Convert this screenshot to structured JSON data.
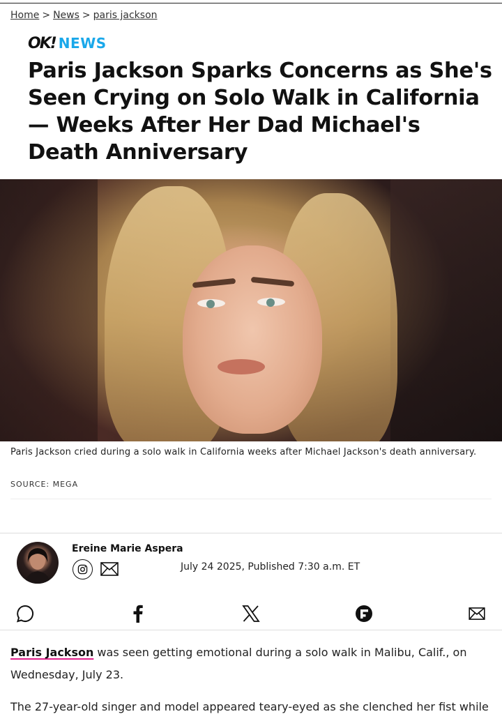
{
  "breadcrumb": {
    "home": "Home",
    "news": "News",
    "current": "paris jackson",
    "separator": ">"
  },
  "brand": {
    "logo": "OK!",
    "section": "NEWS",
    "section_color": "#1aa8ea"
  },
  "headline": "Paris Jackson Sparks Concerns as She's Seen Crying on Solo Walk in California — Weeks After Her Dad Michael's Death Anniversary",
  "hero": {
    "caption": "Paris Jackson cried during a solo walk in California weeks after Michael Jackson's death anniversary.",
    "source": "SOURCE: MEGA"
  },
  "author": {
    "name": "Ereine Marie Aspera",
    "social_icons": [
      "instagram-icon",
      "mail-icon"
    ],
    "date": "July 24 2025, Published 7:30 a.m. ET"
  },
  "share": {
    "icons": [
      "comment-icon",
      "facebook-icon",
      "x-icon",
      "flipboard-icon",
      "mail-icon"
    ]
  },
  "body": {
    "p1_link": "Paris Jackson",
    "p1_text": " was seen getting emotional during a solo walk in Malibu, Calif., on Wednesday, July 23.",
    "p2_text": "The 27-year-old singer and model appeared teary-eyed as she clenched her fist while"
  },
  "colors": {
    "link_underline": "#e0218a",
    "text": "#111111"
  }
}
